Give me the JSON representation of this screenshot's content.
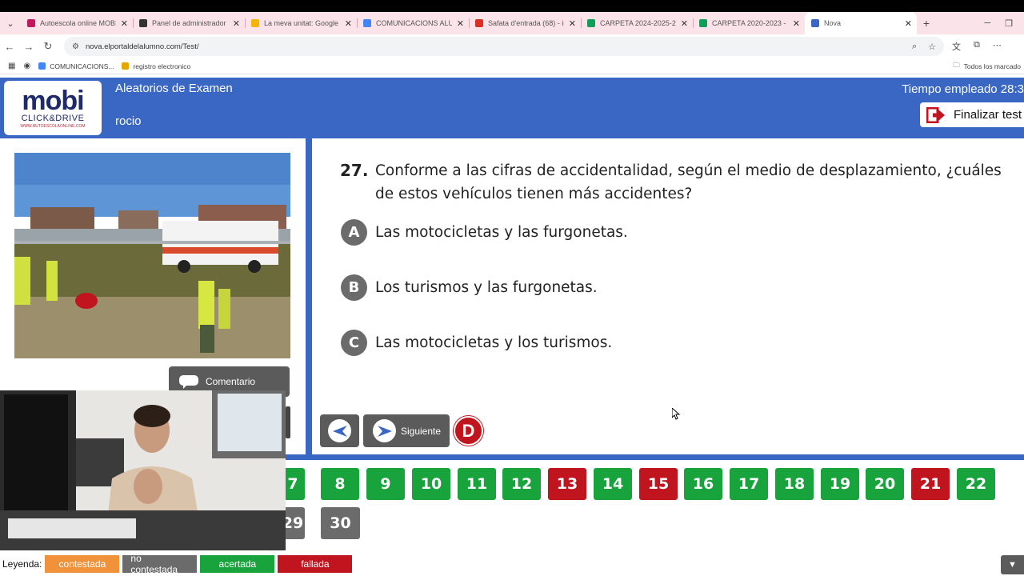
{
  "browser": {
    "tabs": [
      {
        "title": "Autoescola online MOBI |",
        "favicon_color": "#c2185b"
      },
      {
        "title": "Panel de administrador",
        "favicon_color": "#333333"
      },
      {
        "title": "La meva unitat: Google D",
        "favicon_color": "#f4b400"
      },
      {
        "title": "COMUNICACIONS ALUMN",
        "favicon_color": "#4285f4"
      },
      {
        "title": "Safata d'entrada (68) - inf",
        "favicon_color": "#d93025"
      },
      {
        "title": "CARPETA 2024-2025-202",
        "favicon_color": "#0f9d58"
      },
      {
        "title": "CARPETA 2020-2023 - Fu",
        "favicon_color": "#0f9d58"
      },
      {
        "title": "Nova",
        "favicon_color": "#3a67c4"
      }
    ],
    "url": "nova.elportaldelalumno.com/Test/",
    "bookmarks": [
      {
        "label": "COMUNICACIONS...",
        "color": "#4285f4"
      },
      {
        "label": "registro electronico",
        "color": "#e2a800"
      }
    ],
    "bookmarks_right": "Todos los marcado"
  },
  "header": {
    "logo_main": "mobi",
    "logo_sub": "CLICK&DRIVE",
    "logo_web": "WWW.AUTOESCOLAONLINE.COM",
    "title": "Aleatorios de Examen",
    "user": "rocio",
    "time_label": "Tiempo empleado 28:3",
    "finish_label": "Finalizar test"
  },
  "left": {
    "comment_label": "Comentario"
  },
  "question": {
    "number": "27.",
    "text": "Conforme a las cifras de accidentalidad, según el medio de desplazamiento, ¿cuáles de estos vehículos tienen más accidentes?",
    "options": [
      {
        "letter": "A",
        "text": "Las motocicletas y las furgonetas."
      },
      {
        "letter": "B",
        "text": "Los turismos y las furgonetas."
      },
      {
        "letter": "C",
        "text": "Las motocicletas y los turismos."
      }
    ]
  },
  "nav": {
    "next_label": "Siguiente",
    "mark_letter": "D"
  },
  "numbers": [
    {
      "n": "7",
      "status": "acertada"
    },
    {
      "n": "8",
      "status": "acertada"
    },
    {
      "n": "9",
      "status": "acertada"
    },
    {
      "n": "10",
      "status": "acertada"
    },
    {
      "n": "11",
      "status": "acertada"
    },
    {
      "n": "12",
      "status": "acertada"
    },
    {
      "n": "13",
      "status": "fallada"
    },
    {
      "n": "14",
      "status": "acertada"
    },
    {
      "n": "15",
      "status": "fallada"
    },
    {
      "n": "16",
      "status": "acertada"
    },
    {
      "n": "17",
      "status": "acertada"
    },
    {
      "n": "18",
      "status": "acertada"
    },
    {
      "n": "19",
      "status": "acertada"
    },
    {
      "n": "20",
      "status": "acertada"
    },
    {
      "n": "21",
      "status": "fallada"
    },
    {
      "n": "22",
      "status": "acertada"
    },
    {
      "n": "29",
      "status": "no contestada"
    },
    {
      "n": "30",
      "status": "no contestada"
    }
  ],
  "legend": {
    "title": "Leyenda:",
    "items": [
      {
        "label": "contestada",
        "color": "#f0923a"
      },
      {
        "label": "no contestada",
        "color": "#6b6b6b"
      },
      {
        "label": "acertada",
        "color": "#18a33c"
      },
      {
        "label": "fallada",
        "color": "#c0141e"
      }
    ]
  },
  "colors": {
    "brand_blue": "#3a67c4",
    "correct": "#18a33c",
    "wrong": "#c0141e",
    "neutral": "#6b6b6b"
  }
}
